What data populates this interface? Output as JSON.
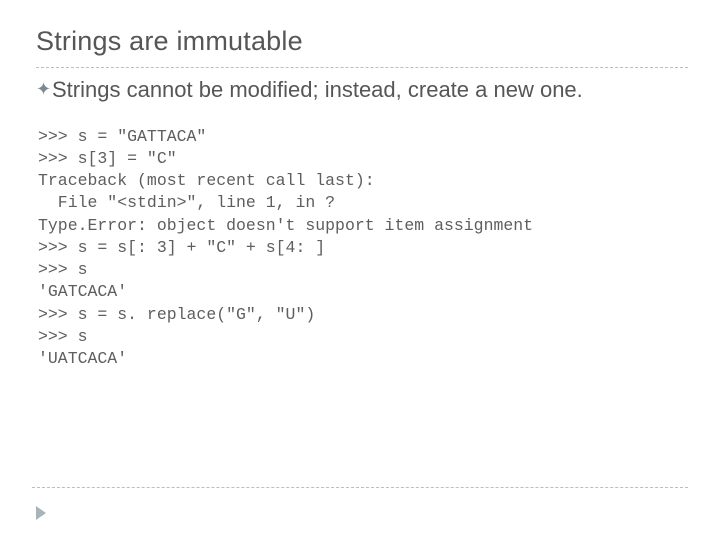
{
  "title": "Strings are immutable",
  "bullet_glyph": "✦",
  "body": "Strings cannot be modified; instead, create a new one.",
  "code_lines": [
    ">>> s = \"GATTACA\"",
    ">>> s[3] = \"C\"",
    "Traceback (most recent call last):",
    "  File \"<stdin>\", line 1, in ?",
    "Type.Error: object doesn't support item assignment",
    ">>> s = s[: 3] + \"C\" + s[4: ]",
    ">>> s",
    "'GATCACA'",
    ">>> s = s. replace(\"G\", \"U\")",
    ">>> s",
    "'UATCACA'"
  ]
}
